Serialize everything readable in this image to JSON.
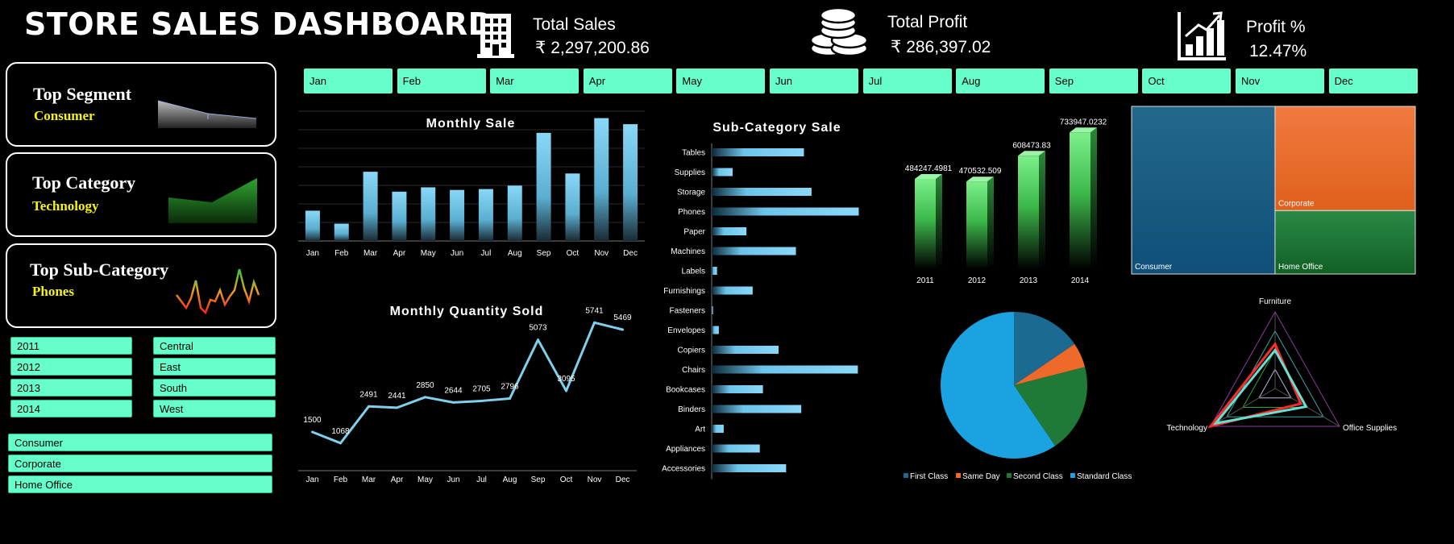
{
  "header": {
    "title": "STORE SALES DASHBOARD"
  },
  "kpis": [
    {
      "label": "Total Sales",
      "value": "₹ 2,297,200.86",
      "icon": "building-icon"
    },
    {
      "label": "Total Profit",
      "value": "₹ 286,397.02",
      "icon": "coins-icon"
    },
    {
      "label": "Profit %",
      "value": "12.47%",
      "icon": "bar-growth-icon"
    }
  ],
  "cards": [
    {
      "title": "Top Segment",
      "value": "Consumer"
    },
    {
      "title": "Top Category",
      "value": "Technology"
    },
    {
      "title": "Top Sub-Category",
      "value": "Phones"
    }
  ],
  "months": [
    "Jan",
    "Feb",
    "Mar",
    "Apr",
    "May",
    "Jun",
    "Jul",
    "Aug",
    "Sep",
    "Oct",
    "Nov",
    "Dec"
  ],
  "slicers": {
    "years": [
      "2011",
      "2012",
      "2013",
      "2014"
    ],
    "regions": [
      "Central",
      "East",
      "South",
      "West"
    ],
    "segments": [
      "Consumer",
      "Corporate",
      "Home Office"
    ]
  },
  "colors": {
    "accent": "#66ffcc",
    "highlight": "#f5f50a",
    "bar_blue": "#7fd0f0"
  },
  "chart_data": [
    {
      "type": "bar",
      "title": "Monthly Sale",
      "categories": [
        "Jan",
        "Feb",
        "Mar",
        "Apr",
        "May",
        "Jun",
        "Jul",
        "Aug",
        "Sep",
        "Oct",
        "Nov",
        "Dec"
      ],
      "values": [
        35,
        20,
        80,
        57,
        62,
        59,
        60,
        64,
        125,
        78,
        142,
        135
      ],
      "ylim": [
        0,
        150
      ],
      "grid": true
    },
    {
      "type": "line",
      "title": "Monthly Quantity Sold",
      "categories": [
        "Jan",
        "Feb",
        "Mar",
        "Apr",
        "May",
        "Jun",
        "Jul",
        "Aug",
        "Sep",
        "Oct",
        "Nov",
        "Dec"
      ],
      "values": [
        1500,
        1068,
        2491,
        2441,
        2850,
        2644,
        2705,
        2796,
        5073,
        3095,
        5741,
        5469
      ],
      "ylim": [
        0,
        6500
      ]
    },
    {
      "type": "bar",
      "title": "Sub-Category Sale",
      "orientation": "horizontal",
      "categories": [
        "Tables",
        "Supplies",
        "Storage",
        "Phones",
        "Paper",
        "Machines",
        "Labels",
        "Furnishings",
        "Fasteners",
        "Envelopes",
        "Copiers",
        "Chairs",
        "Bookcases",
        "Binders",
        "Art",
        "Appliances",
        "Accessories"
      ],
      "values": [
        207,
        47,
        224,
        330,
        78,
        189,
        12,
        92,
        3,
        16,
        150,
        328,
        115,
        201,
        27,
        108,
        167
      ],
      "xlim": [
        0,
        340
      ]
    },
    {
      "type": "bar",
      "title": "",
      "categories": [
        "2011",
        "2012",
        "2013",
        "2014"
      ],
      "values": [
        484247.4981,
        470532.509,
        608473.83,
        733947.0232
      ],
      "labels": [
        "484247.4981",
        "470532.509",
        "608473.83",
        "733947.0232"
      ],
      "ylim": [
        0,
        800000
      ]
    },
    {
      "type": "treemap",
      "categories": [
        "Consumer",
        "Corporate",
        "Home Office"
      ],
      "values": [
        1161401,
        706146,
        429653
      ],
      "colors": [
        "#1b6a92",
        "#ee6a2a",
        "#1e7a36"
      ]
    },
    {
      "type": "pie",
      "categories": [
        "First Class",
        "Same Day",
        "Second Class",
        "Standard Class"
      ],
      "values": [
        15.5,
        5.5,
        19.5,
        59.5
      ],
      "colors": [
        "#1b6a92",
        "#ee6a2a",
        "#1e7a36",
        "#1ba2e0"
      ],
      "legend": "bottom"
    },
    {
      "type": "radar",
      "categories": [
        "Furniture",
        "Office Supplies",
        "Technology"
      ],
      "series": [
        {
          "values": [
            0.58,
            0.4,
            1.0
          ],
          "color": "#ff2a2a"
        },
        {
          "values": [
            0.5,
            0.48,
            0.92
          ],
          "color": "#66e0d0"
        }
      ],
      "rings": 4
    }
  ]
}
